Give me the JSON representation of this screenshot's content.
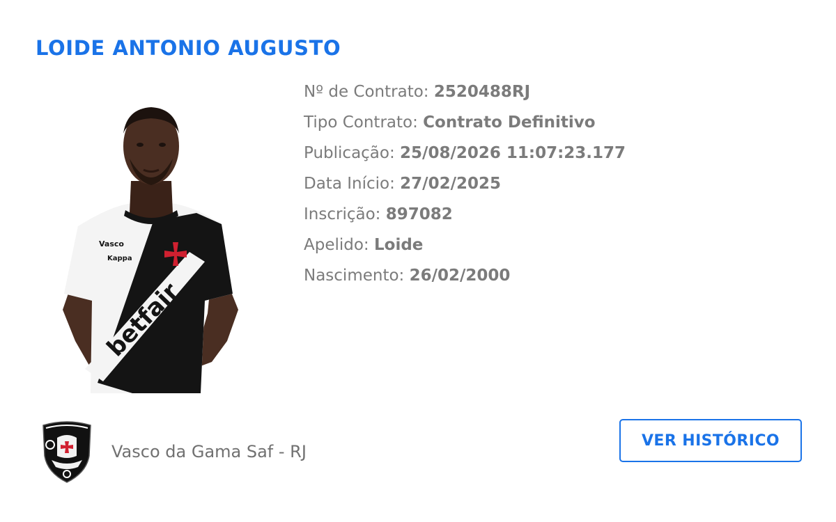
{
  "player": {
    "name": "LOIDE ANTONIO AUGUSTO",
    "photo_alt": "Foto do atleta"
  },
  "details": [
    {
      "label": "Nº de Contrato:",
      "value": "2520488RJ"
    },
    {
      "label": "Tipo Contrato:",
      "value": "Contrato Definitivo"
    },
    {
      "label": "Publicação:",
      "value": "25/08/2026 11:07:23.177"
    },
    {
      "label": "Data Início:",
      "value": "27/02/2025"
    },
    {
      "label": "Inscrição:",
      "value": "897082"
    },
    {
      "label": "Apelido:",
      "value": "Loide"
    },
    {
      "label": "Nascimento:",
      "value": "26/02/2000"
    }
  ],
  "club": {
    "name": "Vasco da Gama Saf - RJ",
    "logo_icon": "vasco-crest-icon"
  },
  "actions": {
    "history_label": "VER HISTÓRICO"
  },
  "colors": {
    "accent": "#1a73e8",
    "label_text": "#7b7b7b",
    "club_text": "#717171"
  },
  "photo_print": {
    "sponsor": "betfair",
    "chest_sponsor": "Vasco",
    "kit_maker": "Kappa"
  }
}
